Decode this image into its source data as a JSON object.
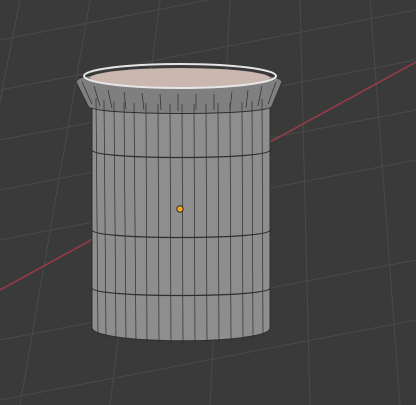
{
  "viewport": {
    "background_color": "#3a3a3a",
    "grid_color": "#4a4a4a",
    "x_axis_color": "#9a3b46"
  },
  "object": {
    "shape": "cylinder",
    "side_count": 24,
    "horizontal_loops": 3,
    "body_color": "#8e8e8e",
    "edge_color": "#2e2e2e",
    "inner_color": "#c9b7b0",
    "rim_color": "#e6e6e6",
    "origin_color": "#f5a623"
  },
  "icons": {
    "origin": "origin-point-icon"
  }
}
